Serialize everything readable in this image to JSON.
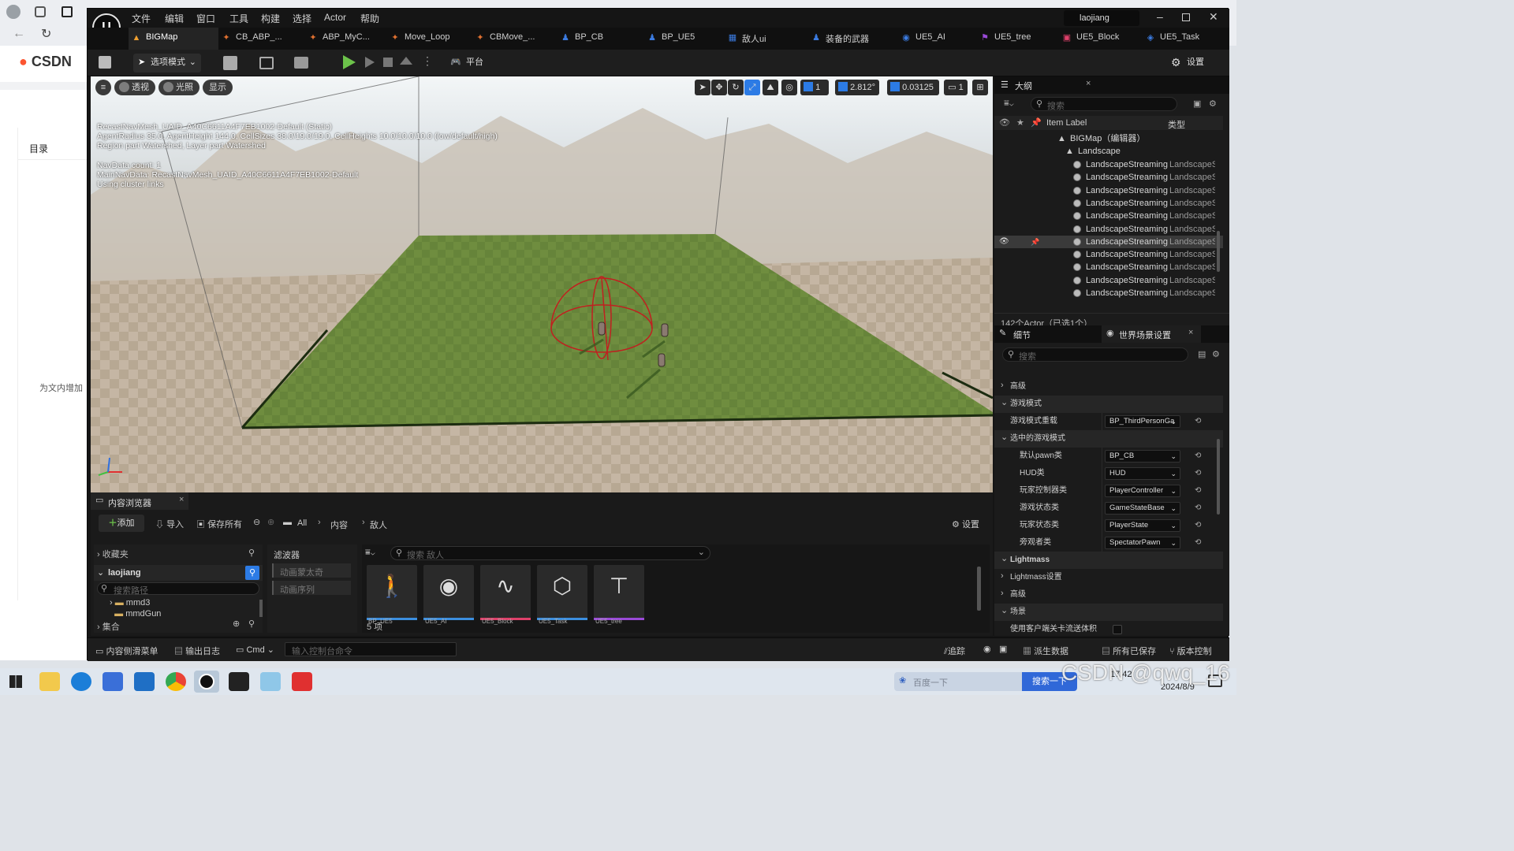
{
  "browser": {
    "logo": "CSDN",
    "toc_label": "目录",
    "side_text": "为文内增加"
  },
  "editor": {
    "user": "laojiang",
    "menu": [
      "文件",
      "编辑",
      "窗口",
      "工具",
      "构建",
      "选择",
      "Actor",
      "帮助"
    ],
    "tabs": [
      {
        "label": "BIGMap",
        "icon": "level-icon",
        "active": true
      },
      {
        "label": "CB_ABP_...",
        "icon": "anim-icon",
        "active": false
      },
      {
        "label": "ABP_MyC...",
        "icon": "anim-icon",
        "active": false
      },
      {
        "label": "Move_Loop",
        "icon": "anim-icon",
        "active": false
      },
      {
        "label": "CBMove_...",
        "icon": "anim-icon",
        "active": false
      },
      {
        "label": "BP_CB",
        "icon": "blueprint-icon",
        "active": false
      },
      {
        "label": "BP_UE5",
        "icon": "blueprint-icon",
        "active": false
      },
      {
        "label": "敌人ui",
        "icon": "widget-icon",
        "active": false
      },
      {
        "label": "装备的武器",
        "icon": "blueprint-icon",
        "active": false
      },
      {
        "label": "UE5_AI",
        "icon": "ai-icon",
        "active": false
      },
      {
        "label": "UE5_tree",
        "icon": "tree-icon",
        "active": false
      },
      {
        "label": "UE5_Block",
        "icon": "block-icon",
        "active": false
      },
      {
        "label": "UE5_Task",
        "icon": "task-icon",
        "active": false
      }
    ],
    "toolbar": {
      "mode_label": "选项模式",
      "platform_label": "平台",
      "settings_label": "设置"
    }
  },
  "viewport": {
    "perspective_label": "透视",
    "lighting_label": "光照",
    "show_label": "显示",
    "grid_value": "1",
    "rotation_value": "2.812°",
    "scale_value": "0.03125",
    "camera_speed": "1",
    "info_lines": [
      "RecastNavMesh_UAID_A40C6611A4F7EB1002-Default (Static)",
      "AgentRadius 35.0, AgentHeight 144.0, CellSizes 38.0/19.0/19.0, CellHeights 10.0/10.0/10.0 (low/default/high)",
      "Region part Watershed, Layer part Watershed",
      "",
      "NavData count: 1",
      "MainNavData: RecastNavMesh_UAID_A40C6611A4F7EB1002-Default",
      "Using cluster links"
    ]
  },
  "outliner": {
    "title": "大纲",
    "search_placeholder": "搜索",
    "col_label": "Item Label",
    "col_type": "类型",
    "root": "BIGMap（编辑器）",
    "group": "Landscape",
    "rows": [
      {
        "label": "LandscapeStreaming",
        "type": "LandscapeS",
        "selected": false
      },
      {
        "label": "LandscapeStreaming",
        "type": "LandscapeS",
        "selected": false
      },
      {
        "label": "LandscapeStreaming",
        "type": "LandscapeS",
        "selected": false
      },
      {
        "label": "LandscapeStreaming",
        "type": "LandscapeS",
        "selected": false
      },
      {
        "label": "LandscapeStreaming",
        "type": "LandscapeS",
        "selected": false
      },
      {
        "label": "LandscapeStreaming",
        "type": "LandscapeS",
        "selected": false
      },
      {
        "label": "LandscapeStreaming",
        "type": "LandscapeS",
        "selected": true
      },
      {
        "label": "LandscapeStreaming",
        "type": "LandscapeS",
        "selected": false
      },
      {
        "label": "LandscapeStreaming",
        "type": "LandscapeS",
        "selected": false
      },
      {
        "label": "LandscapeStreaming",
        "type": "LandscapeS",
        "selected": false
      },
      {
        "label": "LandscapeStreaming",
        "type": "LandscapeS",
        "selected": false
      }
    ],
    "count": "142个Actor（已选1个）"
  },
  "details": {
    "tab_details": "细节",
    "tab_world": "世界场景设置",
    "search_placeholder": "搜索",
    "rows": [
      {
        "kind": "section",
        "label": "高级",
        "open": false
      },
      {
        "kind": "section",
        "label": "游戏模式",
        "open": true
      },
      {
        "kind": "prop",
        "label": "游戏模式重载",
        "value": "BP_ThirdPersonGa",
        "indent": 1
      },
      {
        "kind": "section",
        "label": "选中的游戏模式",
        "open": true,
        "indent": 0
      },
      {
        "kind": "prop",
        "label": "默认pawn类",
        "value": "BP_CB",
        "indent": 2
      },
      {
        "kind": "prop",
        "label": "HUD类",
        "value": "HUD",
        "indent": 2
      },
      {
        "kind": "prop",
        "label": "玩家控制器类",
        "value": "PlayerController",
        "indent": 2
      },
      {
        "kind": "prop",
        "label": "游戏状态类",
        "value": "GameStateBase",
        "indent": 2
      },
      {
        "kind": "prop",
        "label": "玩家状态类",
        "value": "PlayerState",
        "indent": 2
      },
      {
        "kind": "prop",
        "label": "旁观者类",
        "value": "SpectatorPawn",
        "indent": 2
      },
      {
        "kind": "section",
        "label": "Lightmass",
        "open": true
      },
      {
        "kind": "sub",
        "label": "Lightmass设置",
        "open": false
      },
      {
        "kind": "sub",
        "label": "高级",
        "open": false
      },
      {
        "kind": "section",
        "label": "场景",
        "open": true
      },
      {
        "kind": "check",
        "label": "使用客户端关卡流送体积",
        "checked": false
      }
    ]
  },
  "content_browser": {
    "title": "内容浏览器",
    "add_label": "添加",
    "import_label": "导入",
    "save_all_label": "保存所有",
    "path": [
      "All",
      "内容",
      "敌人"
    ],
    "settings_label": "设置",
    "favorites_label": "收藏夹",
    "project_label": "laojiang",
    "search_path_placeholder": "搜索路径",
    "folders": [
      "mmd3",
      "mmdGun"
    ],
    "collections_label": "集合",
    "filters_label": "滤波器",
    "filter_items": [
      "动画蒙太奇",
      "动画序列"
    ],
    "search_placeholder": "搜索 敌人",
    "assets": [
      {
        "name": "BP_UE5",
        "color": "#3b8fe0",
        "icon": "character-icon"
      },
      {
        "name": "UE5_AI",
        "color": "#3b8fe0",
        "icon": "ai-controller-icon"
      },
      {
        "name": "UE5_Block",
        "color": "#e0406a",
        "icon": "blackboard-icon"
      },
      {
        "name": "UE5_Task",
        "color": "#3b8fe0",
        "icon": "task-icon"
      },
      {
        "name": "UE5_tree",
        "color": "#9a4ad8",
        "icon": "behavior-tree-icon"
      }
    ],
    "item_count": "5 项"
  },
  "statusbar": {
    "drawer_label": "内容侧滑菜单",
    "log_label": "输出日志",
    "cmd_label": "Cmd",
    "console_placeholder": "输入控制台命令",
    "trace_label": "追踪",
    "derived_label": "派生数据",
    "saved_label": "所有已保存",
    "version_label": "版本控制"
  },
  "taskbar": {
    "search_placeholder": "百度一下",
    "search_button": "搜索一下",
    "time": "17:42",
    "date": "2024/8/9",
    "watermark": "CSDN @qwq_16"
  },
  "colors": {
    "accent": "#2c7be5",
    "play_green": "#6cc24a",
    "floor_green": "#6f8d3f"
  }
}
